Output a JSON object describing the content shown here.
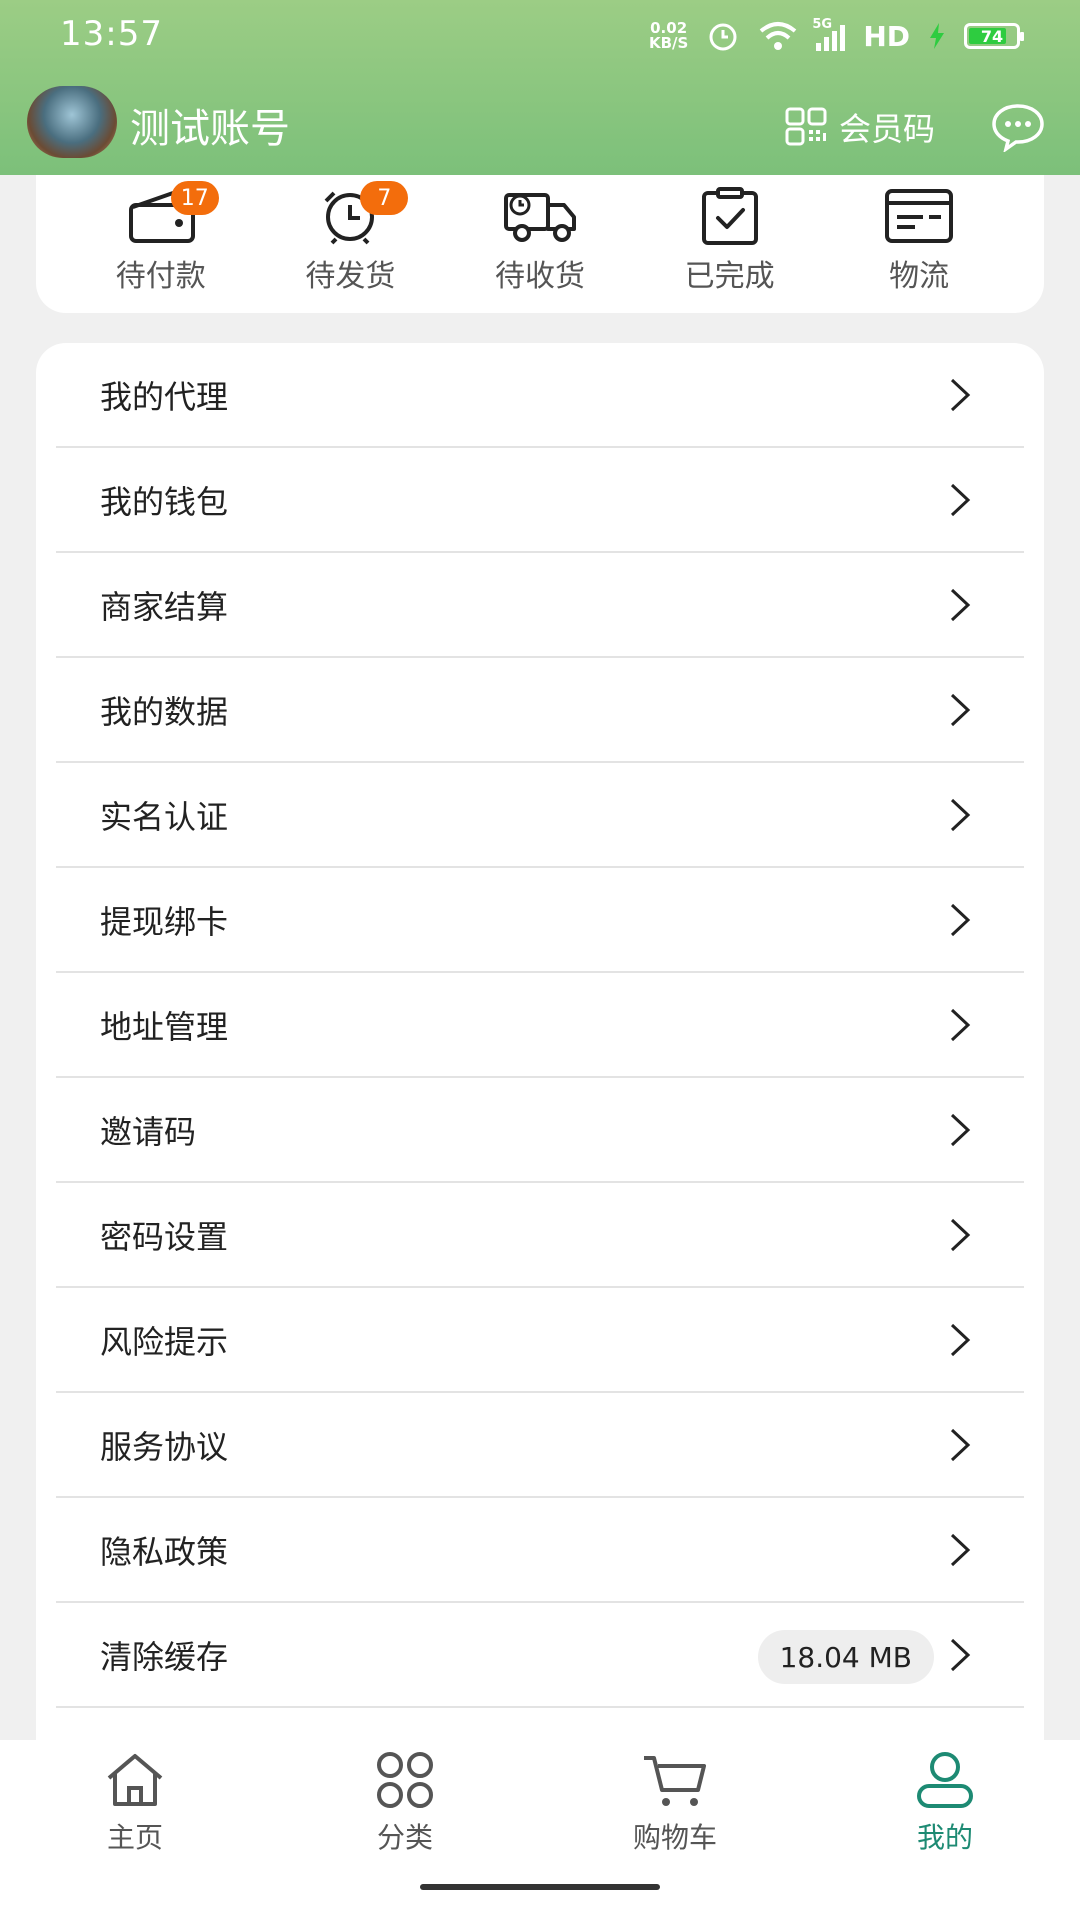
{
  "status_bar": {
    "time": "13:57",
    "net_speed_value": "0.02",
    "net_speed_unit": "KB/S",
    "network": "5G",
    "hd": "HD",
    "battery": "74"
  },
  "header": {
    "username": "测试账号",
    "member_code_label": "会员码"
  },
  "orders": [
    {
      "label": "待付款",
      "badge": "17",
      "icon": "wallet-icon"
    },
    {
      "label": "待发货",
      "badge": "7",
      "icon": "alarm-clock-icon"
    },
    {
      "label": "待收货",
      "badge": "",
      "icon": "delivery-truck-icon"
    },
    {
      "label": "已完成",
      "badge": "",
      "icon": "clipboard-check-icon"
    },
    {
      "label": "物流",
      "badge": "",
      "icon": "card-icon"
    }
  ],
  "menu": [
    {
      "label": "我的代理"
    },
    {
      "label": "我的钱包"
    },
    {
      "label": "商家结算"
    },
    {
      "label": "我的数据"
    },
    {
      "label": "实名认证"
    },
    {
      "label": "提现绑卡"
    },
    {
      "label": "地址管理"
    },
    {
      "label": "邀请码"
    },
    {
      "label": "密码设置"
    },
    {
      "label": "风险提示"
    },
    {
      "label": "服务协议"
    },
    {
      "label": "隐私政策"
    },
    {
      "label": "清除缓存",
      "value": "18.04 MB"
    }
  ],
  "tabs": [
    {
      "label": "主页",
      "icon": "home-icon"
    },
    {
      "label": "分类",
      "icon": "grid-icon"
    },
    {
      "label": "购物车",
      "icon": "cart-icon"
    },
    {
      "label": "我的",
      "icon": "user-icon",
      "active": true
    }
  ],
  "colors": {
    "header_green": "#8cc77f",
    "accent_teal": "#1d8a73",
    "badge_orange": "#f36d0c"
  }
}
